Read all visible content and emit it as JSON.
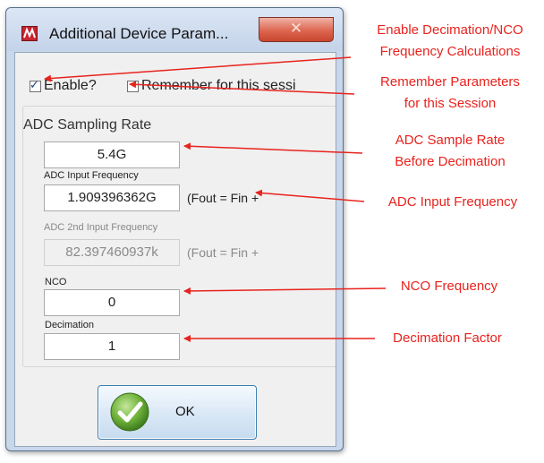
{
  "dialog": {
    "title": "Additional Device Param...",
    "close_symbol": "✕",
    "enable": {
      "label": "Enable?",
      "checked": true
    },
    "remember": {
      "label": "Remember for this sessi",
      "checked": false
    },
    "group_title": "ADC Sampling Rate",
    "sampling_rate": {
      "value": "5.4G"
    },
    "input_freq": {
      "label": "ADC Input  Frequency",
      "value": "1.909396362G",
      "note": "(Fout = Fin +"
    },
    "input_freq2": {
      "label": "ADC 2nd Input  Frequency",
      "value": "82.397460937k",
      "note": "(Fout = Fin +"
    },
    "nco": {
      "label": "NCO",
      "value": "0"
    },
    "decimation": {
      "label": "Decimation",
      "value": "1"
    },
    "ok_label": "OK",
    "icons": {
      "app": "app-logo-icon",
      "ok": "checkmark-icon"
    }
  },
  "annotations": {
    "enable_line1": "Enable Decimation/NCO",
    "enable_line2": "Frequency Calculations",
    "remember_line1": "Remember Parameters",
    "remember_line2": "for this Session",
    "rate_line1": "ADC Sample Rate",
    "rate_line2": "Before Decimation",
    "input_freq": "ADC Input Frequency",
    "nco": "NCO Frequency",
    "decimation": "Decimation Factor",
    "color": "#e8231e"
  }
}
